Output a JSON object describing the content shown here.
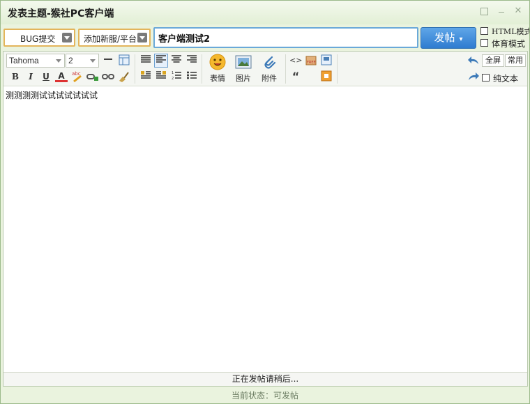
{
  "window": {
    "title": "发表主题-猴社PC客户端",
    "close_glyph": "✕"
  },
  "form": {
    "category": "BUG提交",
    "forum": "添加新服/平台",
    "subject": "客户端测试2",
    "post_label": "发帖",
    "post_caret": "▾",
    "html_mode_label": "HTML模式",
    "sport_mode_label": "体育模式"
  },
  "toolbar": {
    "font": "Tahoma",
    "size": "2",
    "bold": "B",
    "italic": "I",
    "underline": "U",
    "font_color": "A",
    "emoji_label": "表情",
    "image_label": "图片",
    "attachment_label": "附件",
    "code_glyph": "<>",
    "quote_glyph": "“",
    "fullscreen_label": "全屏",
    "common_label": "常用",
    "plaintext_label": "纯文本"
  },
  "editor": {
    "content": "测测测测试试试试试试试"
  },
  "status": {
    "posting_message": "正在发帖请稍后...",
    "current_state": "当前状态：可发帖"
  },
  "colors": {
    "accent": "#2f7cd0",
    "select_border": "#e3b55b",
    "window_bg": "#eaf3de"
  }
}
